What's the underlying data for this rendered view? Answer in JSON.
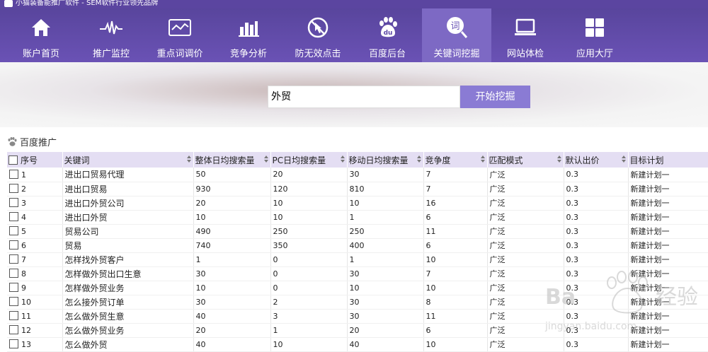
{
  "app": {
    "title": "小猫装备能推广软件 - SEM软件行业领先品牌"
  },
  "nav": [
    {
      "label": "账户首页",
      "icon": "home-icon"
    },
    {
      "label": "推广监控",
      "icon": "pulse-icon"
    },
    {
      "label": "重点词调价",
      "icon": "monitor-chart-icon"
    },
    {
      "label": "竞争分析",
      "icon": "bar-chart-icon"
    },
    {
      "label": "防无效点击",
      "icon": "no-click-icon"
    },
    {
      "label": "百度后台",
      "icon": "baidu-paw-icon"
    },
    {
      "label": "关键词挖掘",
      "icon": "keyword-search-icon",
      "active": true
    },
    {
      "label": "网站体检",
      "icon": "laptop-icon"
    },
    {
      "label": "应用大厅",
      "icon": "apps-grid-icon"
    }
  ],
  "search": {
    "value": "外贸",
    "button": "开始挖掘"
  },
  "section": {
    "title": "百度推广"
  },
  "table": {
    "columns": [
      "序号",
      "关键词",
      "整体日均搜索量",
      "PC日均搜索量",
      "移动日均搜索量",
      "竞争度",
      "匹配模式",
      "默认出价",
      "目标计划"
    ],
    "rows": [
      [
        "1",
        "进出口贸易代理",
        "50",
        "20",
        "30",
        "7",
        "广泛",
        "0.3",
        "新建计划一"
      ],
      [
        "2",
        "进出口贸易",
        "930",
        "120",
        "810",
        "7",
        "广泛",
        "0.3",
        "新建计划一"
      ],
      [
        "3",
        "进出口外贸公司",
        "20",
        "10",
        "10",
        "16",
        "广泛",
        "0.3",
        "新建计划一"
      ],
      [
        "4",
        "进出口外贸",
        "10",
        "10",
        "1",
        "6",
        "广泛",
        "0.3",
        "新建计划一"
      ],
      [
        "5",
        "贸易公司",
        "490",
        "250",
        "250",
        "11",
        "广泛",
        "0.3",
        "新建计划一"
      ],
      [
        "6",
        "贸易",
        "740",
        "350",
        "400",
        "6",
        "广泛",
        "0.3",
        "新建计划一"
      ],
      [
        "7",
        "怎样找外贸客户",
        "1",
        "0",
        "1",
        "10",
        "广泛",
        "0.3",
        "新建计划一"
      ],
      [
        "8",
        "怎样做外贸出口生意",
        "30",
        "0",
        "30",
        "7",
        "广泛",
        "0.3",
        "新建计划一"
      ],
      [
        "9",
        "怎样做外贸业务",
        "10",
        "0",
        "10",
        "10",
        "广泛",
        "0.3",
        "新建计划一"
      ],
      [
        "10",
        "怎么接外贸订单",
        "30",
        "2",
        "30",
        "8",
        "广泛",
        "0.3",
        "新建计划一"
      ],
      [
        "11",
        "怎么做外贸生意",
        "40",
        "3",
        "30",
        "11",
        "广泛",
        "0.3",
        "新建计划一"
      ],
      [
        "12",
        "怎么做外贸业务",
        "20",
        "1",
        "20",
        "6",
        "广泛",
        "0.3",
        "新建计划一"
      ],
      [
        "13",
        "怎么做外贸",
        "40",
        "10",
        "40",
        "10",
        "广泛",
        "0.3",
        "新建计划一"
      ]
    ]
  },
  "watermark": {
    "text": "Baidu经验",
    "url": "jingyan.baidu.com"
  }
}
